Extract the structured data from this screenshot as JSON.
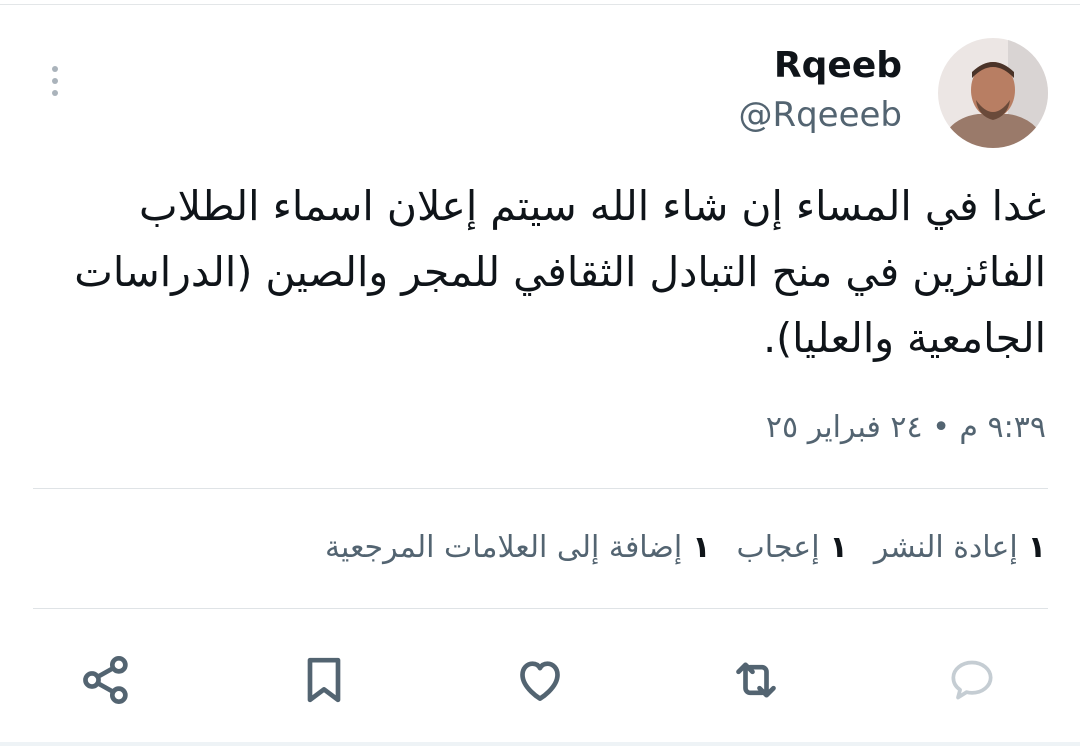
{
  "tweet": {
    "author": {
      "display_name": "Rqeeb",
      "handle": "@Rqeeeb"
    },
    "text": "غدا في المساء إن شاء الله سيتم إعلان اسماء الطلاب الفائزين في منح التبادل الثقافي للمجر والصين (الدراسات الجامعية والعليا).",
    "timestamp": "٩:٣٩ م • ٢٤ فبراير ٢٥",
    "stats": [
      {
        "count": "١",
        "label": "إعادة النشر"
      },
      {
        "count": "١",
        "label": "إعجاب"
      },
      {
        "count": "١",
        "label": "إضافة إلى العلامات المرجعية"
      }
    ]
  },
  "actions": [
    "reply-icon",
    "repost-icon",
    "like-icon",
    "bookmark-icon",
    "share-icon"
  ],
  "colors": {
    "text_primary": "#0f1419",
    "text_secondary": "#536471",
    "icon": "#536471",
    "divider": "#dfe3e6"
  }
}
